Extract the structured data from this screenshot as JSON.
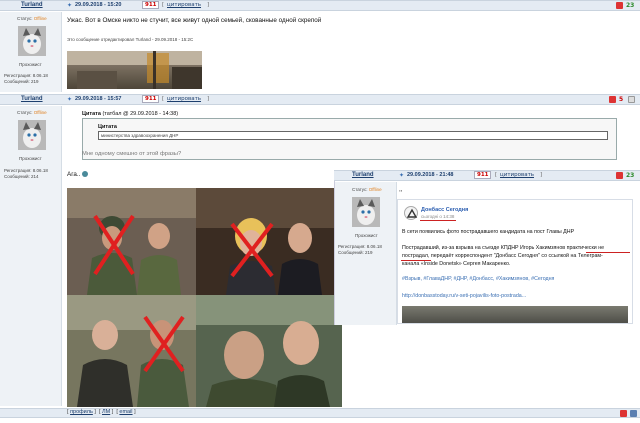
{
  "post1": {
    "author": "Turland",
    "datetime": "29.09.2018 - 15:20",
    "post_number": "911",
    "quote_label": "цитировать",
    "score": "23",
    "status_label": "Статус:",
    "status_value": "Offline",
    "rank": "Прохожист",
    "reg_label": "Регистрация: 8.06.18",
    "msgs_label": "Сообщений: 219",
    "text": "Ужас. Вот в Омске никто не стучит, все живут одной семьей, скованные одной скрепой",
    "edited": "Это сообщение отредактировал Turland - 29.09.2018 - 15:2С"
  },
  "post2": {
    "author": "Turland",
    "datetime": "29.09.2018 - 15:57",
    "post_number": "911",
    "quote_label": "цитировать",
    "score": "5",
    "status_label": "Статус:",
    "status_value": "Offline",
    "rank": "Прохожист",
    "reg_label": "Регистрация: 8.06.18",
    "msgs_label": "Сообщений: 214",
    "quote_header": "Цитата",
    "quote_meta": "(татбал @ 29.09.2018 - 14:38)",
    "inner_quote_header": "Цитата",
    "inner_quote_text": "министерства здравоохранения ДНР",
    "question": "Мне одному смешно от этой фразы?",
    "aga": "Ага.."
  },
  "post3": {
    "author": "Turland",
    "datetime": "29.09.2018 - 21:48",
    "post_number": "911",
    "quote_label": "цитировать",
    "score": "23",
    "status_label": "Статус:",
    "status_value": "Offline",
    "rank": "Прохожист",
    "reg_label": "Регистрация: 8.06.18",
    "msgs_label": "Сообщений: 219",
    "dots": ",,"
  },
  "tweet": {
    "account": "Донбасс Сегодня",
    "time": "сьогодні о 14:38",
    "line1": "В сети появились фото пострадавшего кандидата на пост Главы ДНР",
    "line2": "Пострадавший, из-за взрыва на съезде КПДНР Игорь Хакимзянов практически не",
    "line3": "пострадал, передаёт корреспондент \"Донбасс Сегодня\" со ссылкой на Телеграм-",
    "line4": "канала «Inside Donetsk» Сергея Макаренко.",
    "tags": "#Взрыв, #ГлаваДНР, #ДНР, #Донбасс, #Хакимзянов, #Сегодня",
    "link": "http://donbasstoday.ru/v-seti-pojavilis-foto-postrada..."
  },
  "footer": {
    "profile": "профиль",
    "pm": "ЛМ",
    "email": "email"
  },
  "colors": {
    "bar_bg": "#e4ebf3",
    "author": "#1d3f6e",
    "offline": "#e08020",
    "accent_red": "#cc2222"
  }
}
